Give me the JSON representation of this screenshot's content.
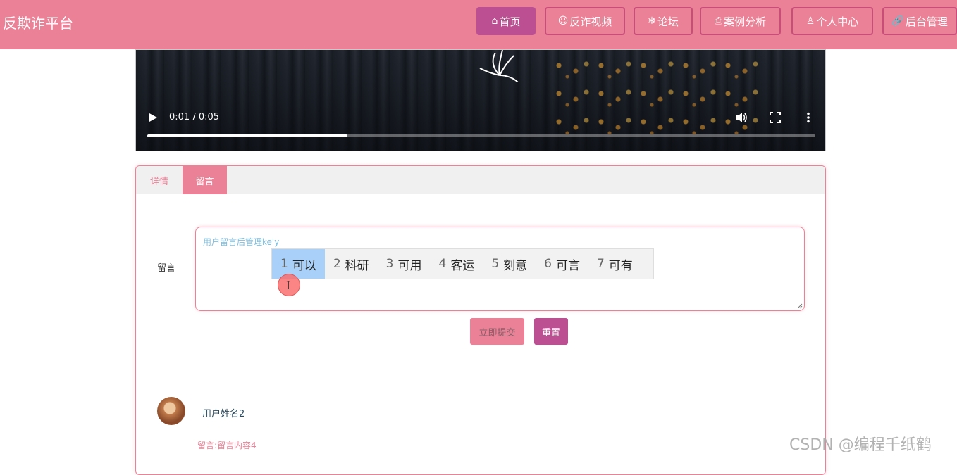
{
  "header": {
    "brand": "反欺诈平台",
    "nav": [
      {
        "label": "首页",
        "icon": "home-icon"
      },
      {
        "label": "反诈视频",
        "icon": "emoji-icon"
      },
      {
        "label": "论坛",
        "icon": "snowflake-icon"
      },
      {
        "label": "案例分析",
        "icon": "printer-icon"
      },
      {
        "label": "个人中心",
        "icon": "user-icon"
      },
      {
        "label": "后台管理",
        "icon": "link-icon"
      }
    ]
  },
  "video": {
    "time": "0:01 / 0:05",
    "progress_fraction": 0.3
  },
  "tabs": [
    "详情",
    "留言"
  ],
  "form": {
    "label": "留言",
    "value": "用户留言后管理ke'y",
    "submit": "立即提交",
    "reset": "重置"
  },
  "ime": {
    "candidates": [
      {
        "n": "1",
        "w": "可以"
      },
      {
        "n": "2",
        "w": "科研"
      },
      {
        "n": "3",
        "w": "可用"
      },
      {
        "n": "4",
        "w": "客运"
      },
      {
        "n": "5",
        "w": "刻意"
      },
      {
        "n": "6",
        "w": "可言"
      },
      {
        "n": "7",
        "w": "可有"
      }
    ]
  },
  "comments": [
    {
      "user": "用户姓名2",
      "text": "留言:留言内容4"
    }
  ],
  "watermark": "CSDN @编程千纸鹤",
  "colors": {
    "primary": "#ea8196",
    "accent": "#bb4f92",
    "ime_selected": "#a8d0f8"
  }
}
